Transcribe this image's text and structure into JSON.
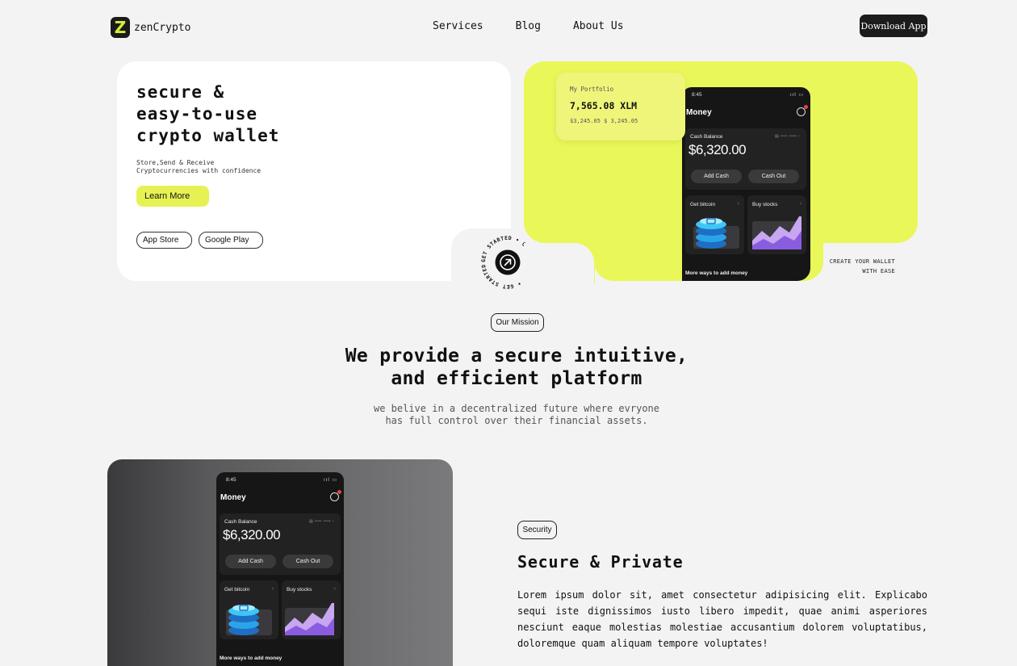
{
  "nav": {
    "logo_letter": "Z",
    "brand": "zenCrypto",
    "links": [
      "Services",
      "Blog",
      "About Us"
    ],
    "cta": "Download App"
  },
  "hero": {
    "title": "secure &\neasy-to-use\ncrypto wallet",
    "subtitle": "Store,Send & Receive\nCryptocurrencies with confidence",
    "learn_more": "Learn More",
    "app_store": "App Store",
    "google_play": "Google Play",
    "badge_text": "GET STARTED • GET STARTED • GET STARTED •",
    "create_text": "CREATE YOUR WALLET\nWITH EASE"
  },
  "portfolio": {
    "label": "My Portfolio",
    "value": "7,565.08 XLM",
    "sub": "$3,245.05   $ 3,245.05"
  },
  "phone": {
    "time": "8:45",
    "status": "ııl ▭",
    "title": "Money",
    "cash_label": "Cash Balance",
    "card_mask": "▤ •••• ••••  ›",
    "balance": "$6,320.00",
    "add_cash": "Add Cash",
    "cash_out": "Cash Out",
    "tile1": "Get bitcoin",
    "tile2": "Buy stocks",
    "more": "More ways to add money"
  },
  "mission": {
    "pill": "Our Mission",
    "title": "We provide a secure intuitive,\nand efficient platform",
    "subtitle": "we belive in a decentralized future where evryone\nhas full control over their financial assets."
  },
  "security": {
    "pill": "Security",
    "title": "Secure & Private",
    "body": "Lorem ipsum dolor sit, amet consectetur adipisicing elit. Explicabo sequi iste dignissimos iusto libero impedit, quae animi asperiores nesciunt eaque molestias molestiae accusantium dolorem voluptatibus, doloremque quam aliquam tempore voluptates!"
  },
  "colors": {
    "accent": "#e9f758",
    "dark": "#161616",
    "background": "#f3f3f3"
  }
}
